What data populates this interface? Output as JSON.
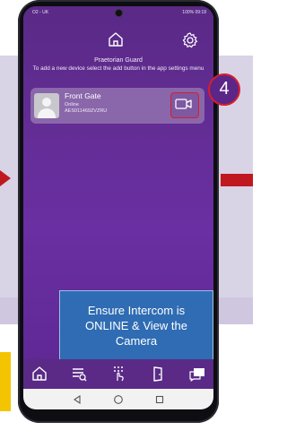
{
  "status_bar": {
    "carrier": "O2 - UK",
    "battery_text": "100%",
    "time": "09:18"
  },
  "header": {
    "title": "Praetorian Guard",
    "instruction": "To add a new device select the add button in the app settings menu"
  },
  "device": {
    "name": "Front Gate",
    "status": "Online",
    "serial": "AES011469ZVZRU"
  },
  "annotation": {
    "step_number": "4",
    "callout_text": "Ensure Intercom is ONLINE & View the Camera"
  },
  "icons": {
    "home": "home-icon",
    "settings": "gear-icon",
    "camera": "video-camera-icon",
    "tabs": [
      "home-icon",
      "call-log-icon",
      "keypad-touch-icon",
      "door-icon",
      "message-icon"
    ],
    "nav": [
      "back-icon",
      "home-circle-icon",
      "recents-icon"
    ]
  },
  "colors": {
    "app_purple": "#5b2c8a",
    "card": "#8a67aa",
    "highlight_red": "#d81e2a",
    "callout_blue": "#2f6cb3",
    "arrow_red": "#c0181f",
    "yellow": "#f5c400"
  }
}
